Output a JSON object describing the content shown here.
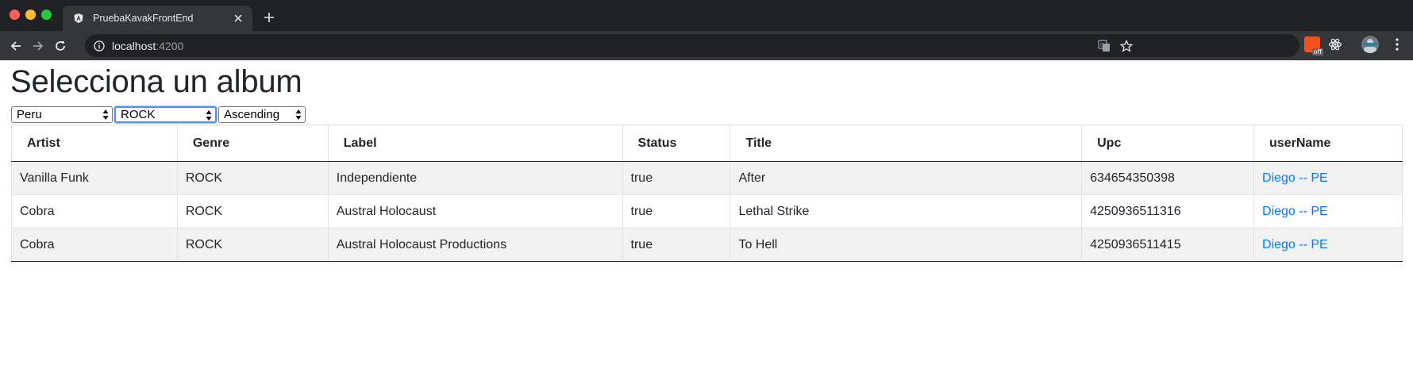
{
  "browser": {
    "tab_title": "PruebaKavakFrontEnd",
    "tab_favicon": "angular-icon",
    "url_host": "localhost",
    "url_port": ":4200",
    "ext_off_badge": "off"
  },
  "page": {
    "title": "Selecciona un album",
    "filters": {
      "country": "Peru",
      "genre": "ROCK",
      "order": "Ascending"
    },
    "table": {
      "headers": [
        "Artist",
        "Genre",
        "Label",
        "Status",
        "Title",
        "Upc",
        "userName"
      ],
      "rows": [
        [
          "Vanilla Funk",
          "ROCK",
          "Independiente",
          "true",
          "After",
          "634654350398",
          "Diego -- PE"
        ],
        [
          "Cobra",
          "ROCK",
          "Austral Holocaust",
          "true",
          "Lethal Strike",
          "4250936511316",
          "Diego -- PE"
        ],
        [
          "Cobra",
          "ROCK",
          "Austral Holocaust Productions",
          "true",
          "To Hell",
          "4250936511415",
          "Diego -- PE"
        ]
      ]
    }
  },
  "colors": {
    "link": "#007bff",
    "focus": "#4d90fe",
    "stripe": "#f2f2f2"
  }
}
